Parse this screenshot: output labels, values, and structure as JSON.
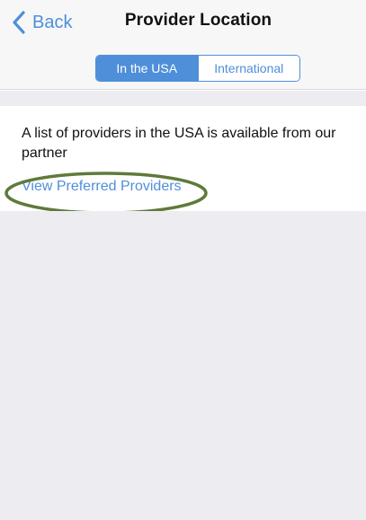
{
  "nav": {
    "back_label": "Back",
    "title": "Provider Location"
  },
  "segments": {
    "options": [
      "In the USA",
      "International"
    ],
    "selected": "In the USA"
  },
  "content": {
    "info_text": "A list of providers in the USA is available from our partner",
    "link_label": "View Preferred Providers"
  },
  "colors": {
    "accent": "#4f8fd9",
    "background": "#ededf1",
    "navbar": "#f7f7f8",
    "highlight_ellipse": "#5f7a3a"
  },
  "icons": {
    "back": "chevron-left-icon"
  }
}
